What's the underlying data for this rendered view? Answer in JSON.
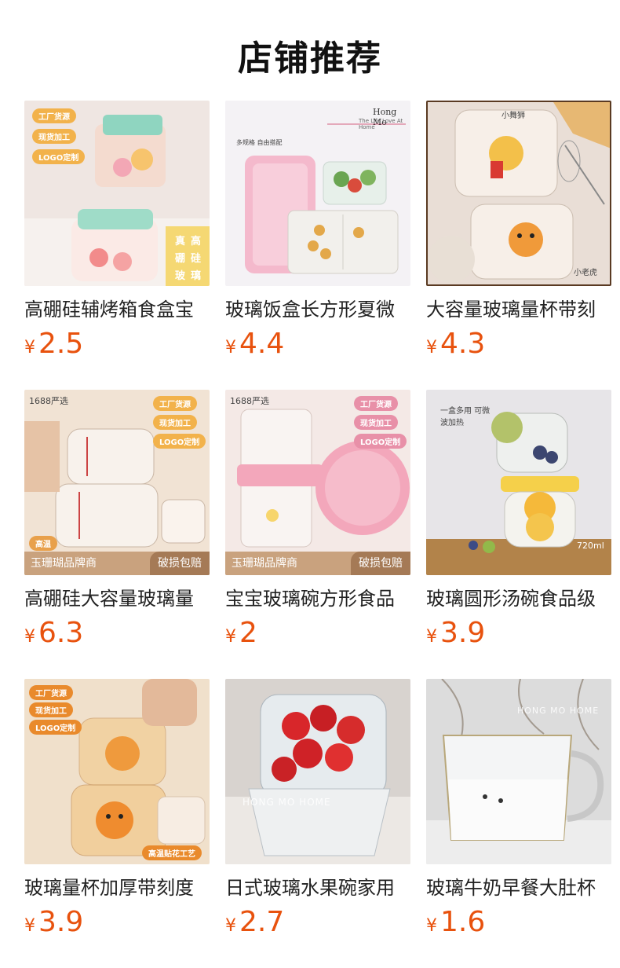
{
  "page": {
    "title": "店铺推荐"
  },
  "products": [
    {
      "name": "高硼硅辅烤箱食盒宝",
      "currency": "¥",
      "price": "2.5",
      "image_tags": [
        "工厂货源",
        "现货加工",
        "LOGO定制"
      ],
      "image_side_text": [
        "真",
        "高",
        "硼",
        "硅",
        "玻",
        "璃"
      ]
    },
    {
      "name": "玻璃饭盒长方形夏微",
      "currency": "¥",
      "price": "4.4",
      "image_brand": "Hong  Mo",
      "image_subtitle": "The Life Love At Home",
      "image_small_text": "多规格 自由搭配"
    },
    {
      "name": "大容量玻璃量杯带刻",
      "currency": "¥",
      "price": "4.3",
      "image_label_top": "小舞狮",
      "image_label_bottom": "小老虎"
    },
    {
      "name": "高硼硅大容量玻璃量",
      "currency": "¥",
      "price": "6.3",
      "image_corner": "1688严选",
      "image_tags": [
        "工厂货源",
        "现货加工",
        "LOGO定制"
      ],
      "image_badge": "高温",
      "image_banner_left": "玉珊瑚品牌商",
      "image_banner_right": "破损包赔"
    },
    {
      "name": "宝宝玻璃碗方形食品",
      "currency": "¥",
      "price": "2",
      "image_corner": "1688严选",
      "image_tags": [
        "工厂货源",
        "现货加工",
        "LOGO定制"
      ],
      "image_banner_left": "玉珊瑚品牌商",
      "image_banner_right": "破损包赔"
    },
    {
      "name": "玻璃圆形汤碗食品级",
      "currency": "¥",
      "price": "3.9",
      "image_bubble": "一盒多用 可微波加热",
      "image_volume": "720ml"
    },
    {
      "name": "玻璃量杯加厚带刻度",
      "currency": "¥",
      "price": "3.9",
      "image_tags": [
        "工厂货源",
        "现货加工",
        "LOGO定制"
      ],
      "image_badge": "高温贴花工艺"
    },
    {
      "name": "日式玻璃水果碗家用",
      "currency": "¥",
      "price": "2.7",
      "image_watermark": "HONG MO HOME"
    },
    {
      "name": "玻璃牛奶早餐大肚杯",
      "currency": "¥",
      "price": "1.6",
      "image_watermark": "HONG MO HOME"
    }
  ]
}
